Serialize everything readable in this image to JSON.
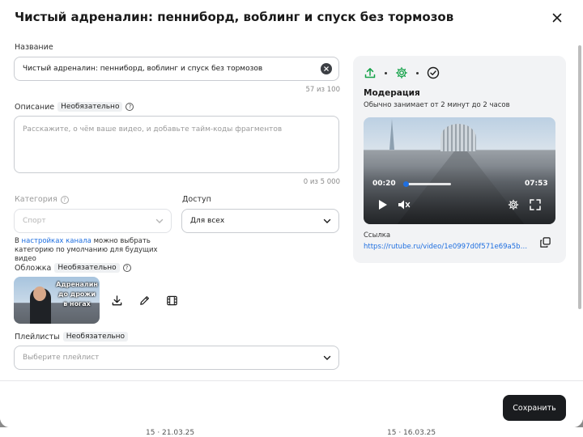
{
  "modal": {
    "title": "Чистый адреналин: пенниборд, воблинг и спуск без тормозов"
  },
  "form": {
    "name_label": "Название",
    "name_value": "Чистый адреналин: пенниборд, воблинг и спуск без тормозов",
    "name_counter": "57 из 100",
    "description_label": "Описание",
    "optional_badge": "Необязательно",
    "description_placeholder": "Расскажите, о чём ваше видео, и добавьте тайм-коды фрагментов",
    "description_counter": "0 из 5 000",
    "category_label": "Категория",
    "category_placeholder": "Спорт",
    "access_label": "Доступ",
    "access_value": "Для всех",
    "hint_prefix": "В",
    "hint_link": "настройках канала",
    "hint_suffix": "можно выбрать категорию по умолчанию для будущих видео",
    "cover_label": "Обложка",
    "cover_text": "Адреналин до дрожи в ногах",
    "playlists_label": "Плейлисты",
    "playlists_placeholder": "Выберите плейлист"
  },
  "moderation": {
    "title": "Модерация",
    "subtitle": "Обычно занимает от 2 минут до 2 часов",
    "current_time": "00:20",
    "duration": "07:53",
    "progress": 0.04,
    "link_label": "Ссылка",
    "link_url": "https://rutube.ru/video/1e0997d0f571e69a5b06..."
  },
  "footer": {
    "save_label": "Сохранить"
  },
  "colors": {
    "accent": "#1f6fe0",
    "step_green": "#16a34a",
    "primary_button": "#1a1c1f"
  },
  "background": {
    "stats_left": "15 · 21.03.25",
    "stats_right": "15 · 16.03.25"
  }
}
